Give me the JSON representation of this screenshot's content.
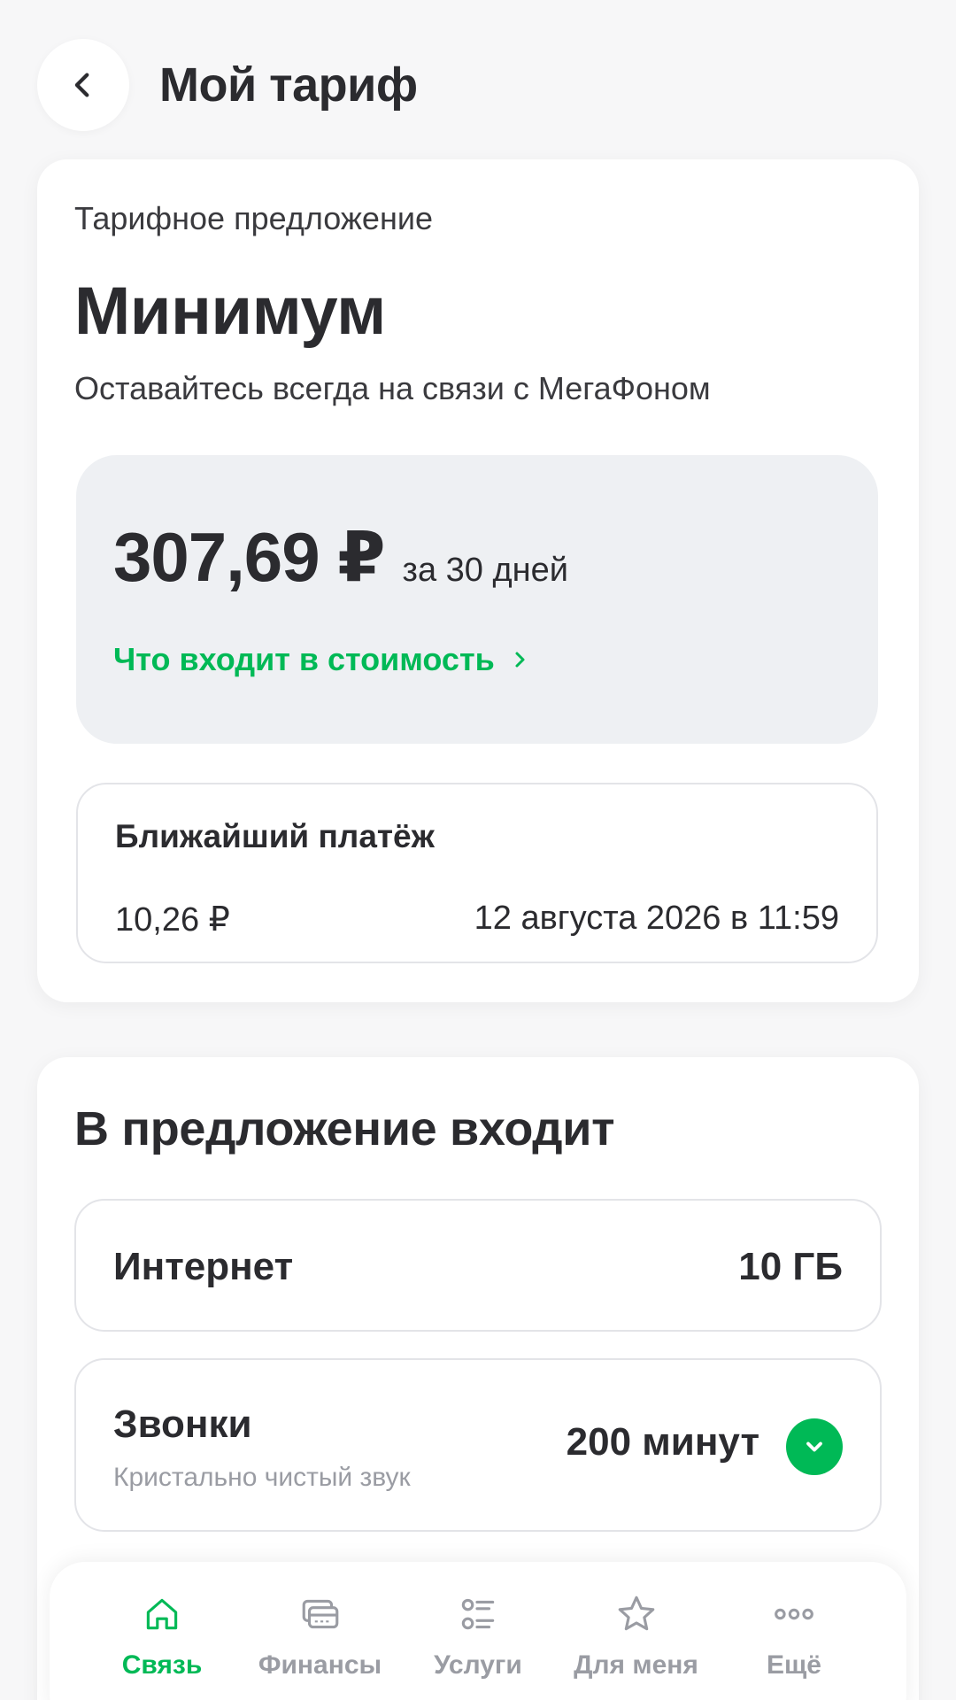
{
  "header": {
    "title": "Мой тариф",
    "back_icon": "chevron-left-icon"
  },
  "tariff": {
    "offer_label": "Тарифное предложение",
    "name": "Минимум",
    "description": "Оставайтесь всегда на связи с МегаФоном",
    "price": "307,69 ₽",
    "period": "за 30 дней",
    "details_link": "Что входит в стоимость"
  },
  "payment": {
    "title": "Ближайший платёж",
    "amount": "10,26 ₽",
    "date": "12 августа 2026 в 11:59"
  },
  "includes": {
    "title": "В предложение входит",
    "items": [
      {
        "name": "Интернет",
        "value": "10 ГБ"
      },
      {
        "name": "Звонки",
        "subtitle": "Кристально чистый звук",
        "value": "200 минут"
      }
    ]
  },
  "nav": [
    {
      "label": "Связь",
      "icon": "home-icon",
      "active": true
    },
    {
      "label": "Финансы",
      "icon": "cards-icon",
      "active": false
    },
    {
      "label": "Услуги",
      "icon": "services-list-icon",
      "active": false
    },
    {
      "label": "Для меня",
      "icon": "star-icon",
      "active": false
    },
    {
      "label": "Ещё",
      "icon": "more-dots-icon",
      "active": false
    }
  ],
  "colors": {
    "accent": "#00B956",
    "text": "#2B2B2F",
    "muted": "#9A9CA3",
    "background": "#F7F7F8",
    "price_box": "#EEF0F3"
  }
}
